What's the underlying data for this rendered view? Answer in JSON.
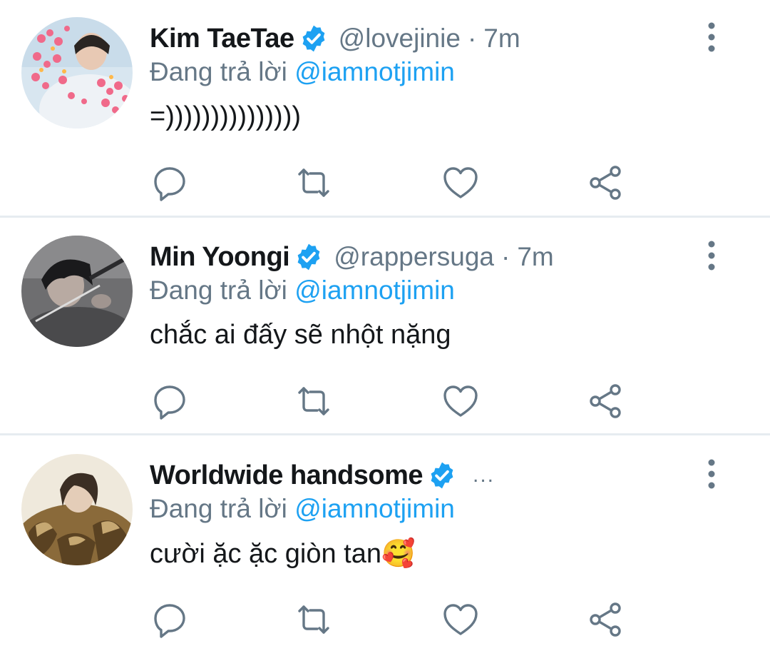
{
  "colors": {
    "primary_text": "#14171a",
    "secondary_text": "#657786",
    "mention": "#1da1f2",
    "verified_badge": "#1da1f2",
    "divider": "#e6ecf0",
    "icon": "#657786"
  },
  "tweets": [
    {
      "display_name": "Kim TaeTae",
      "verified": true,
      "handle": "@lovejinie",
      "separator": "·",
      "time": "7m",
      "reply_prefix": "Đang trả lời",
      "reply_to": "@iamnotjimin",
      "text": "=)))))))))))))))",
      "avatar_icon": "user-avatar-hearts",
      "actions": [
        "reply-icon",
        "retweet-icon",
        "like-icon",
        "share-icon"
      ]
    },
    {
      "display_name": "Min Yoongi",
      "verified": true,
      "handle": "@rappersuga",
      "separator": "·",
      "time": "7m",
      "reply_prefix": "Đang trả lời",
      "reply_to": "@iamnotjimin",
      "text": "chắc ai đấy sẽ nhột nặng",
      "avatar_icon": "user-avatar-dark",
      "actions": [
        "reply-icon",
        "retweet-icon",
        "like-icon",
        "share-icon"
      ]
    },
    {
      "display_name": "Worldwide handsome",
      "verified": true,
      "truncated_meta": "...",
      "reply_prefix": "Đang trả lời",
      "reply_to": "@iamnotjimin",
      "text": "cười ặc ặc giòn tan🥰",
      "avatar_icon": "user-avatar-fur",
      "actions": [
        "reply-icon",
        "retweet-icon",
        "like-icon",
        "share-icon"
      ]
    }
  ]
}
